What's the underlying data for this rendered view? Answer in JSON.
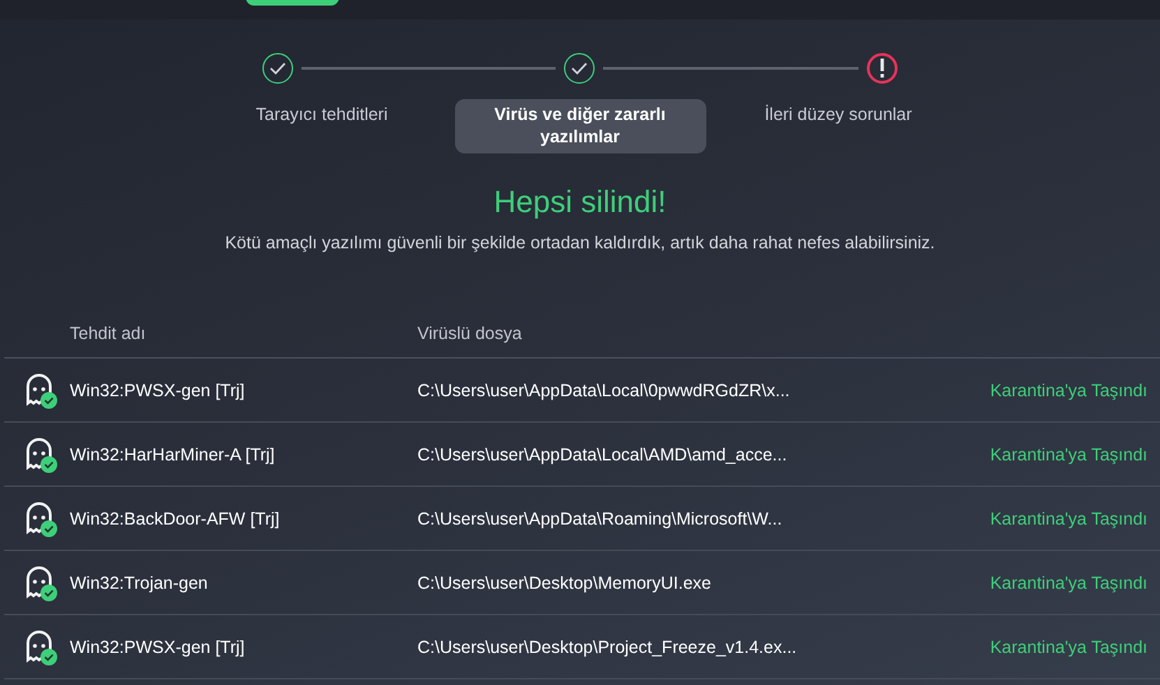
{
  "steps": [
    {
      "label": "Tarayıcı tehditleri",
      "complete": true,
      "selected": false
    },
    {
      "label": "Virüs ve diğer zararlı yazılımlar",
      "complete": true,
      "selected": true
    },
    {
      "label": "İleri düzey sorunlar",
      "complete": false,
      "selected": false
    }
  ],
  "result": {
    "title": "Hepsi silindi!",
    "message": "Kötü amaçlı yazılımı güvenli bir şekilde ortadan kaldırdık, artık daha rahat nefes alabilirsiniz."
  },
  "table": {
    "columns": [
      "Tehdit adı",
      "Virüslü dosya"
    ],
    "rows": [
      {
        "name": "Win32:PWSX-gen [Trj]",
        "file": "C:\\Users\\user\\AppData\\Local\\0pwwdRGdZR\\x...",
        "status": "Karantina'ya Taşındı"
      },
      {
        "name": "Win32:HarHarMiner-A [Trj]",
        "file": "C:\\Users\\user\\AppData\\Local\\AMD\\amd_acce...",
        "status": "Karantina'ya Taşındı"
      },
      {
        "name": "Win32:BackDoor-AFW [Trj]",
        "file": "C:\\Users\\user\\AppData\\Roaming\\Microsoft\\W...",
        "status": "Karantina'ya Taşındı"
      },
      {
        "name": "Win32:Trojan-gen",
        "file": "C:\\Users\\user\\Desktop\\MemoryUI.exe",
        "status": "Karantina'ya Taşındı"
      },
      {
        "name": "Win32:PWSX-gen [Trj]",
        "file": "C:\\Users\\user\\Desktop\\Project_Freeze_v1.4.ex...",
        "status": "Karantina'ya Taşındı"
      }
    ]
  }
}
